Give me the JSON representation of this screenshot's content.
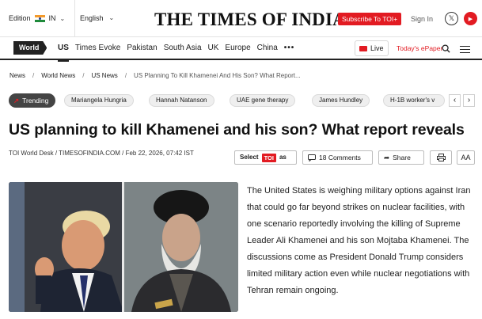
{
  "topbar": {
    "edition_label": "Edition",
    "edition_code": "IN",
    "language": "English",
    "logo_text": "THE TIMES OF INDIA",
    "subscribe_label": "Subscribe To TOI+",
    "signin_label": "Sign In",
    "social_icons": [
      "x-icon",
      "youtube-icon"
    ]
  },
  "nav": {
    "section": "World",
    "items": [
      "US",
      "Times Evoke",
      "Pakistan",
      "South Asia",
      "UK",
      "Europe",
      "China"
    ],
    "more_label": "•••",
    "live_label": "Live",
    "epaper_label": "Today's ePaper"
  },
  "breadcrumb": [
    "News",
    "World News",
    "US News",
    "US Planning To Kill Khamenei And His Son? What Report..."
  ],
  "trending": {
    "label": "Trending",
    "chips": [
      "Mariangela Hungria",
      "Hannah Natanson",
      "UAE gene therapy",
      "James Hundley",
      "H-1B worker's v"
    ]
  },
  "article": {
    "headline": "US planning to kill Khamenei and his son? What report reveals",
    "byline": "TOI World Desk / TIMESOFINDIA.COM / Feb 22, 2026, 07:42 IST",
    "select_label": "Select",
    "toi_label": "TOI",
    "as_label": "as",
    "comments_label": "18 Comments",
    "share_label": "Share",
    "font_size_label": "AA",
    "body": "The United States is weighing military options against Iran that could go far beyond strikes on nuclear facilities, with one scenario reportedly involving the killing of Supreme Leader Ali Khamenei and his son Mojtaba Khamenei. The discussions come as President Donald Trump considers limited military action even while nuclear negotiations with Tehran remain ongoing."
  },
  "colors": {
    "brand_red": "#e21b22",
    "dark": "#222222"
  }
}
